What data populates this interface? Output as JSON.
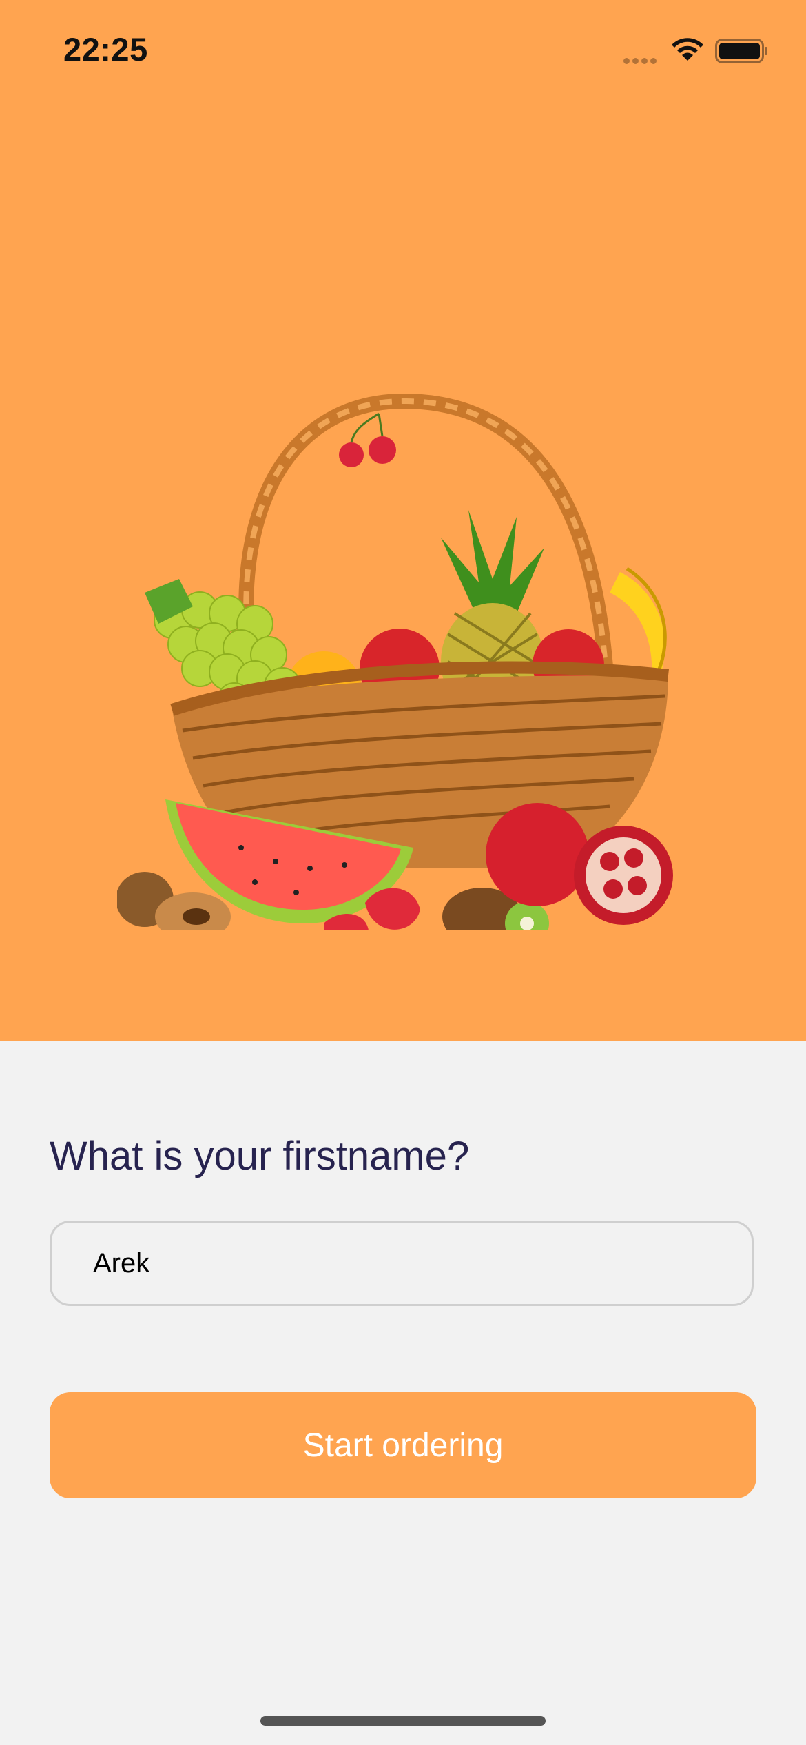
{
  "status_bar": {
    "time": "22:25",
    "signal_icon": "cellular-signal-icon",
    "wifi_icon": "wifi-icon",
    "battery_icon": "battery-icon"
  },
  "hero": {
    "background_color": "#ffa450",
    "illustration": "fruit-basket-illustration"
  },
  "form": {
    "question": "What is your firstname?",
    "name_value": "Arek",
    "start_button_label": "Start ordering"
  },
  "colors": {
    "accent": "#ffa450",
    "question_text": "#27234f",
    "page_background": "#f2f2f2"
  }
}
